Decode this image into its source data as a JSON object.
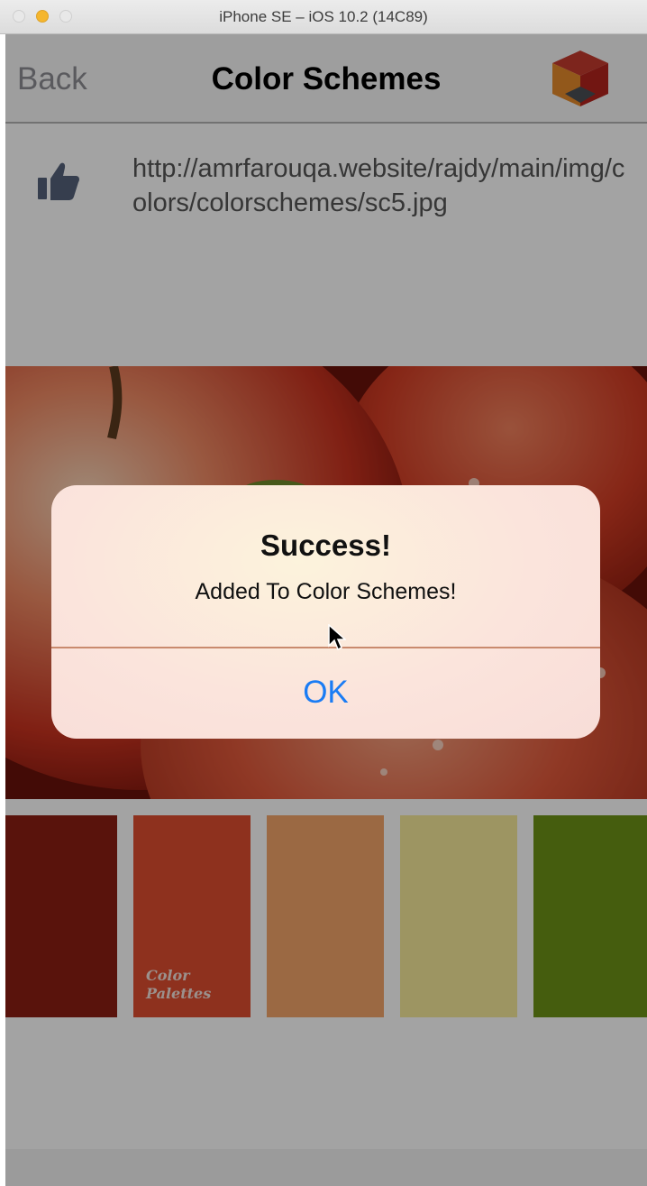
{
  "simulator": {
    "title": "iPhone SE – iOS 10.2 (14C89)"
  },
  "navbar": {
    "back_label": "Back",
    "title": "Color Schemes",
    "logo_icon": "cube-logo-icon"
  },
  "content": {
    "like_icon": "thumbs-up-icon",
    "url": "http://amrfarouqa.website/rajdy/main/img/colors/colorschemes/sc5.jpg",
    "swatches": [
      {
        "color": "#8c1f14"
      },
      {
        "color": "#de4d30",
        "caption_line1": "Color",
        "caption_line2": "Palettes"
      },
      {
        "color": "#f3a46a"
      },
      {
        "color": "#f6ea99"
      },
      {
        "color": "#6d9216"
      }
    ]
  },
  "alert": {
    "title": "Success!",
    "message": "Added To Color Schemes!",
    "ok_label": "OK",
    "ok_color": "#1a7cf4"
  }
}
